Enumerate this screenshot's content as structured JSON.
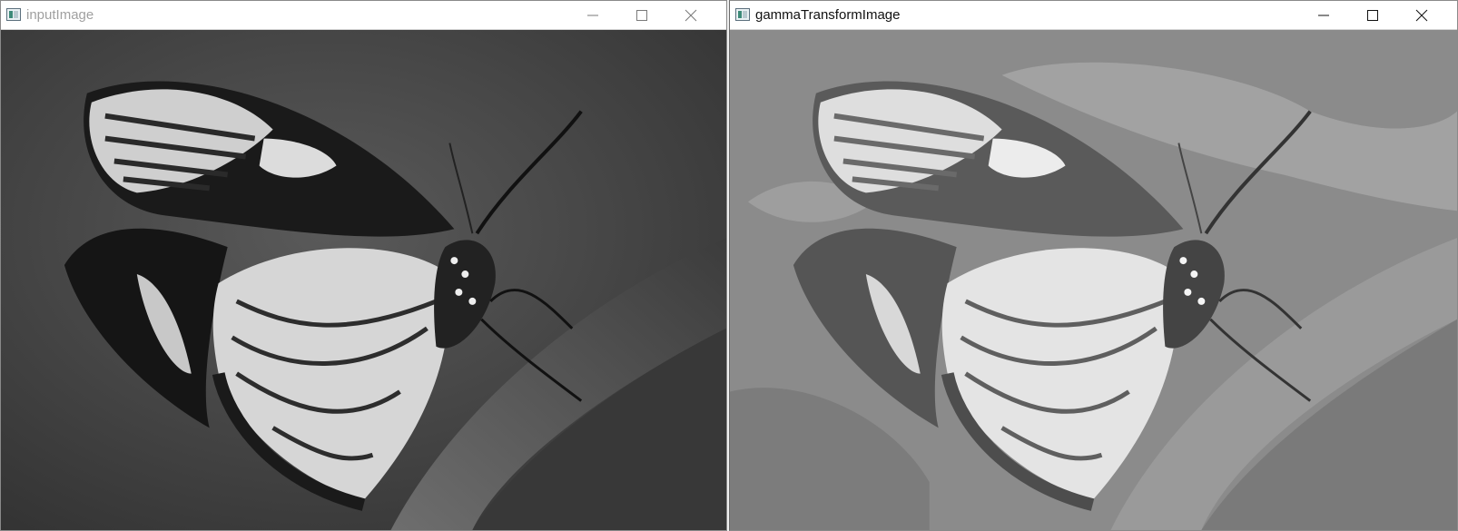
{
  "windows": [
    {
      "title": "inputImage",
      "active": false,
      "icon": "opencv-window-icon",
      "controls": [
        "minimize-icon",
        "maximize-icon",
        "close-icon"
      ],
      "image": {
        "tone": "dark-grayscale",
        "subject": "butterfly-on-leaf"
      }
    },
    {
      "title": "gammaTransformImage",
      "active": true,
      "icon": "opencv-window-icon",
      "controls": [
        "minimize-icon",
        "maximize-icon",
        "close-icon"
      ],
      "image": {
        "tone": "bright-posterized-grayscale",
        "subject": "butterfly-on-leaf"
      }
    }
  ],
  "colors": {
    "inactive_title": "#a0a0a0",
    "active_title": "#111111",
    "left_background": "#4a4a4a",
    "right_background": "#8a8a8a"
  }
}
